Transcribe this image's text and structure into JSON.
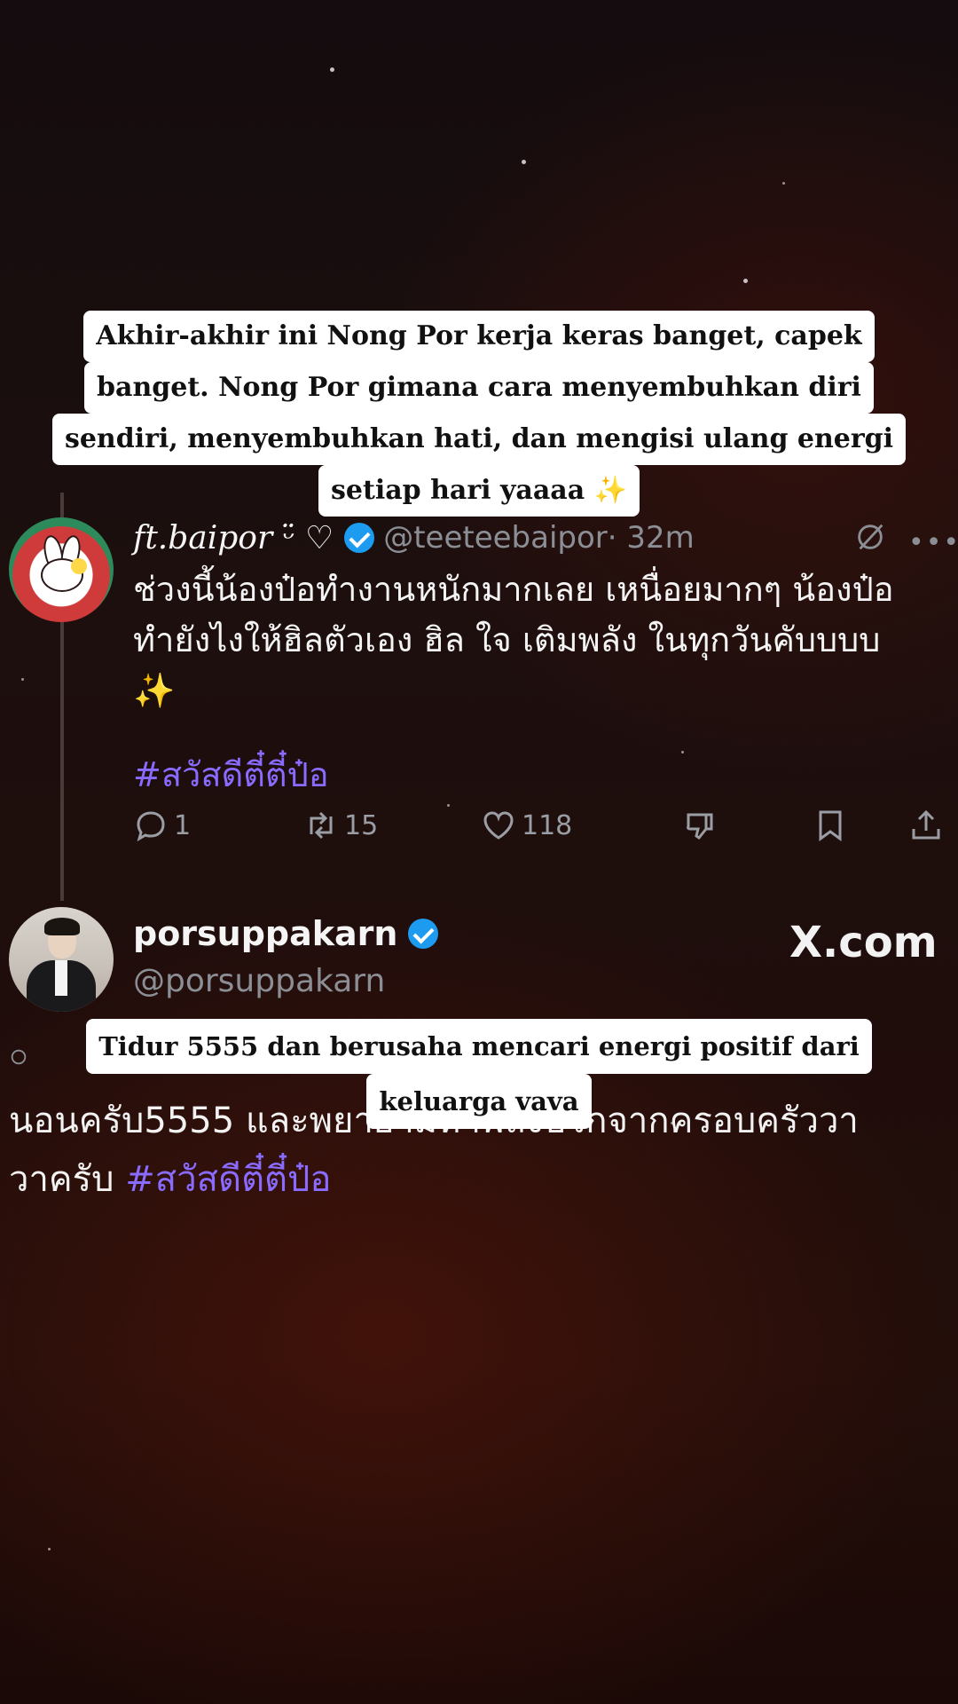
{
  "caption_top": {
    "lines": [
      "Akhir-akhir ini Nong Por kerja keras banget, capek",
      "banget. Nong Por gimana cara menyembuhkan diri",
      "sendiri, menyembuhkan hati, dan mengisi ulang energi",
      "setiap hari yaaaa ✨"
    ]
  },
  "tweet1": {
    "display_name": "𝑓𝑡.baipor ᵕ̈ ♡",
    "handle": "@teeteebaipor",
    "time": "· 32m",
    "text_line1": "ช่วงนี้น้องป๋อทำงานหนักมากเลย เหนื่อยมากๆ น้องป๋อ",
    "text_line2": "ทำยังไงให้ฮิลตัวเอง ฮิล ใจ เติมพลัง ในทุกวันคับบบบ",
    "sparkle": "✨",
    "hashtag": "#สวัสดีตี๋ตี๋ป๋อ",
    "replies": "1",
    "reposts": "15",
    "likes": "118",
    "icons": [
      "grok-icon",
      "more-icon",
      "reply-icon",
      "repost-icon",
      "like-icon",
      "dislike-icon",
      "bookmark-icon",
      "share-icon"
    ]
  },
  "tweet2": {
    "display_name": "porsuppakarn",
    "handle": "@porsuppakarn",
    "watermark": "X.com",
    "text_line1": "นอนครับ5555 และพยายามหาพลังบวกจากครอบครัววา",
    "text_line2_prefix": "วาครับ",
    "hashtag": "#สวัสดีตี๋ตี๋ป๋อ"
  },
  "caption_bottom": {
    "lines": [
      "Tidur 5555 dan berusaha mencari energi positif dari",
      "keluarga vava"
    ]
  },
  "colors": {
    "hashtag": "#8a6bff",
    "verified": "#1d9bf0",
    "secondary_text": "#8b8f95",
    "sparkle": "#ffd54a"
  }
}
